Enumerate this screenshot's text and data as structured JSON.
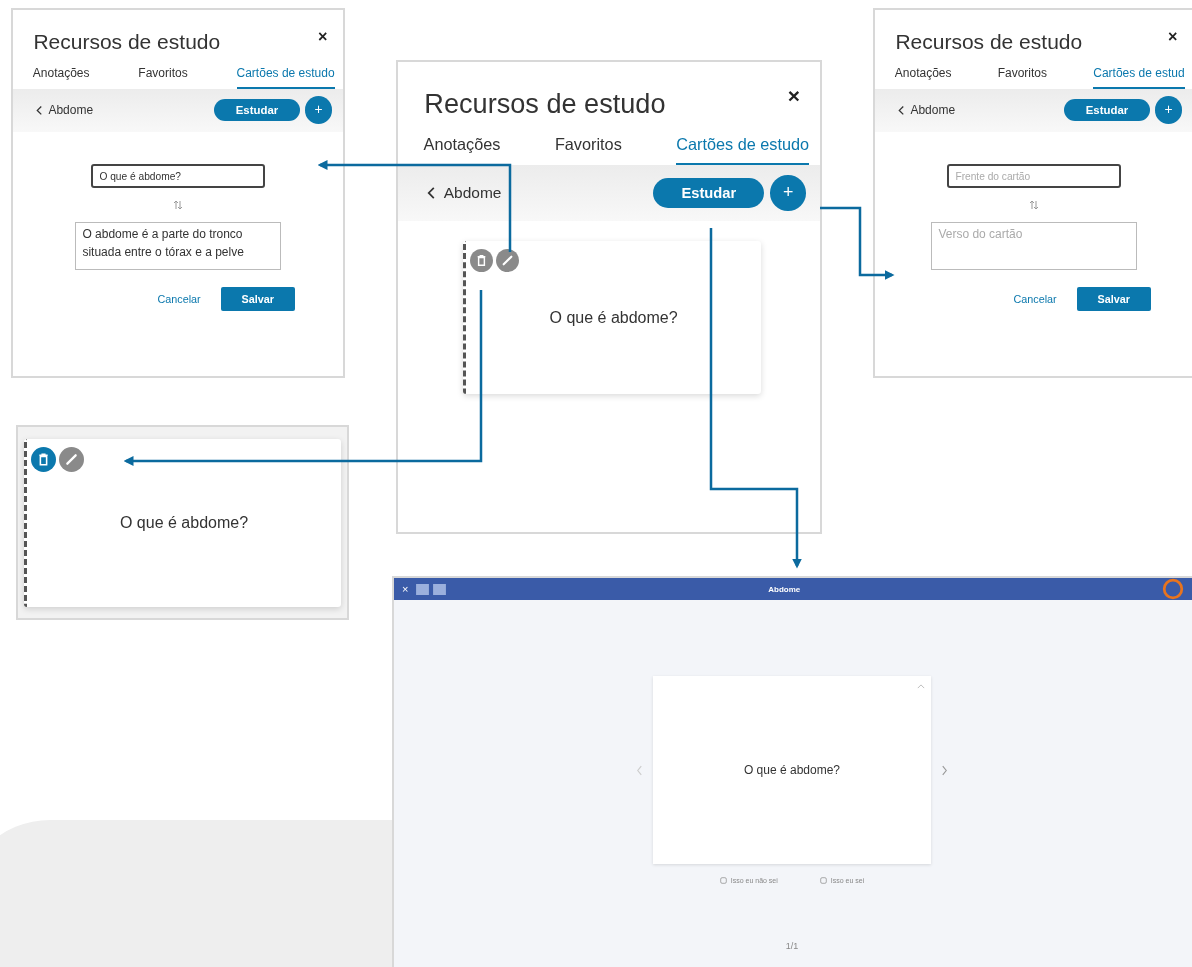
{
  "edit_panel": {
    "title": "Recursos de estudo",
    "close": "×",
    "tabs": [
      {
        "label": "Anotações",
        "selected": false
      },
      {
        "label": "Favoritos",
        "selected": false
      },
      {
        "label": "Cartões de estudo",
        "selected": true
      }
    ],
    "back": "Abdome",
    "study": "Estudar",
    "add": "+",
    "front_field": {
      "value": "O que é abdome?"
    },
    "back_field": {
      "value": "O abdome é a parte do tronco situada entre o tórax e a pelve"
    },
    "cancel": "Cancelar",
    "save": "Salvar"
  },
  "new_panel": {
    "title": "Recursos de estudo",
    "close": "×",
    "tabs": [
      {
        "label": "Anotações",
        "selected": false
      },
      {
        "label": "Favoritos",
        "selected": false
      },
      {
        "label": "Cartões de estud",
        "selected": true
      }
    ],
    "back": "Abdome",
    "study": "Estudar",
    "add": "+",
    "front_field": {
      "placeholder": "Frente do cartão"
    },
    "back_field": {
      "placeholder": "Verso do cartão"
    },
    "cancel": "Cancelar",
    "save": "Salvar"
  },
  "main_panel": {
    "title": "Recursos de estudo",
    "close": "×",
    "tabs": [
      {
        "label": "Anotações",
        "selected": false
      },
      {
        "label": "Favoritos",
        "selected": false
      },
      {
        "label": "Cartões de estudo",
        "selected": true
      }
    ],
    "back": "Abdome",
    "study": "Estudar",
    "add": "+",
    "card": {
      "question": "O que é abdome?",
      "delete_active": false
    }
  },
  "card_detail": {
    "question": "O que é abdome?",
    "delete_active": true
  },
  "study_screen": {
    "close": "×",
    "title": "Abdome",
    "question": "O que é abdome?",
    "answers": [
      "Isso eu não sei",
      "Isso eu sei"
    ],
    "pager": "1/1"
  }
}
